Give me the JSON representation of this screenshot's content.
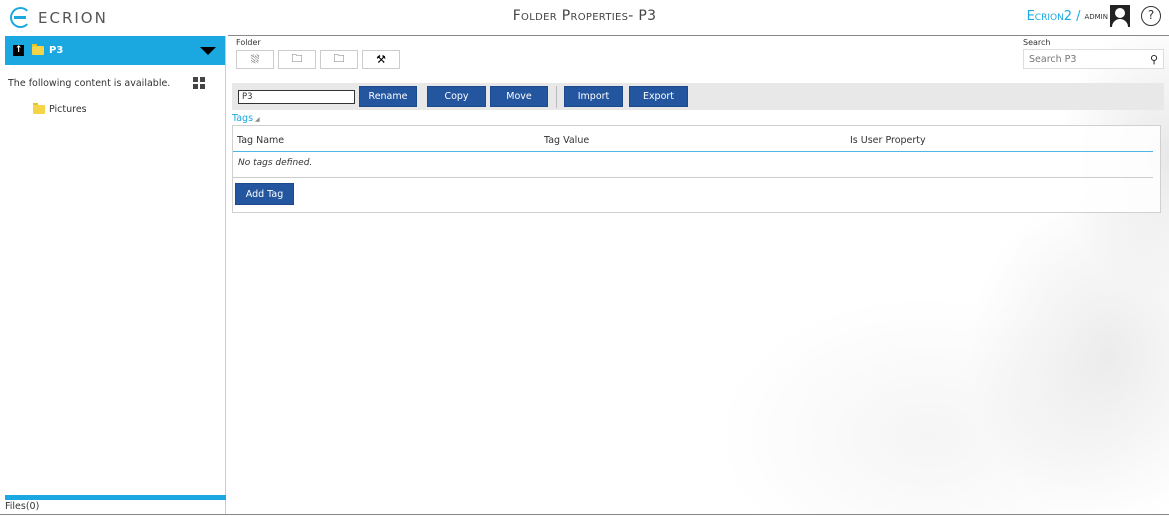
{
  "app": {
    "logo_text": "ECRION",
    "page_title": "Folder Properties- P3",
    "environment": "Ecrion2",
    "separator": "/",
    "user": "admin",
    "help_label": "?"
  },
  "sidebar": {
    "current_folder": "P3",
    "up_icon": "↑",
    "availability_text": "The following content is available.",
    "items": [
      {
        "label": "Pictures",
        "icon": "folder-icon"
      }
    ],
    "footer": "Files(0)"
  },
  "toolbar": {
    "group_label": "Folder",
    "buttons": [
      {
        "name": "upload",
        "icon": "upload-cloud-icon",
        "glyph": "⛆"
      },
      {
        "name": "new-folder",
        "icon": "new-folder-icon",
        "glyph": "🗀"
      },
      {
        "name": "new-subfolder",
        "icon": "new-subfolder-icon",
        "glyph": "🗀"
      },
      {
        "name": "tools",
        "icon": "tools-icon",
        "glyph": "⚒"
      }
    ]
  },
  "search": {
    "label": "Search",
    "placeholder": "Search P3",
    "icon": "🔍"
  },
  "actions": {
    "name_value": "P3",
    "rename": "Rename",
    "copy": "Copy",
    "move": "Move",
    "import": "Import",
    "export": "Export"
  },
  "tags": {
    "title": "Tags",
    "collapse_glyph": "◢",
    "columns": [
      "Tag Name",
      "Tag Value",
      "Is User Property"
    ],
    "empty_text": "No tags defined.",
    "add_label": "Add Tag"
  },
  "colors": {
    "accent": "#1ba8e0",
    "button": "#2456a0"
  }
}
